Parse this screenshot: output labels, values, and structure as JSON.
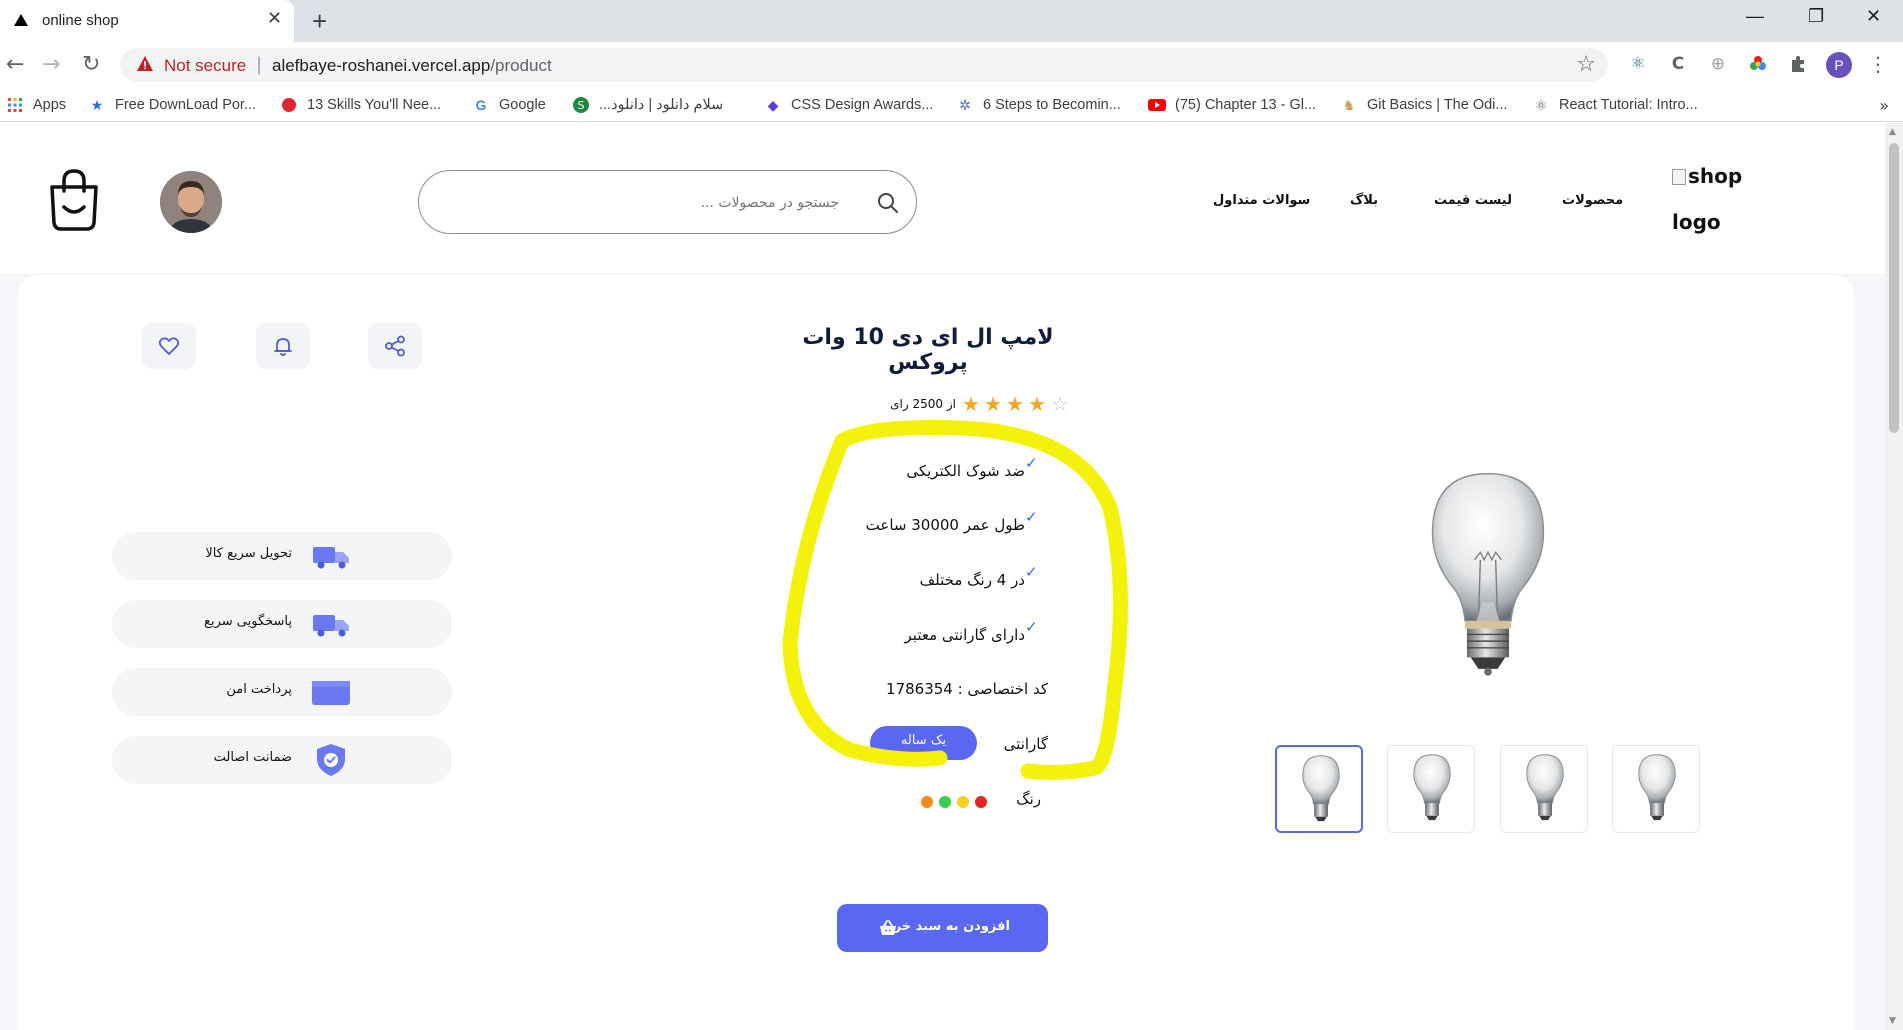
{
  "browser": {
    "tab_title": "online shop",
    "tab_close": "✕",
    "new_tab": "+",
    "url_warning": "Not secure",
    "url_host": "alefbaye-roshanei.vercel.app",
    "url_path": "/product",
    "profile_initial": "P",
    "window_controls": {
      "minimize": "—",
      "restore": "❐",
      "close": "✕"
    }
  },
  "bookmarks": [
    {
      "label": "Apps",
      "icon": "apps-grid-icon"
    },
    {
      "label": "Free DownLoad Por...",
      "icon": "star-icon"
    },
    {
      "label": "13 Skills You'll Nee...",
      "icon": "red-circle-icon"
    },
    {
      "label": "Google",
      "icon": "google-icon"
    },
    {
      "label": "سلام دانلود | دانلود...",
      "icon": "green-s-icon"
    },
    {
      "label": "CSS Design Awards...",
      "icon": "cssda-icon"
    },
    {
      "label": "6 Steps to Becomin...",
      "icon": "snowflake-icon"
    },
    {
      "label": "(75) Chapter 13 - Gl...",
      "icon": "youtube-icon"
    },
    {
      "label": "Git Basics | The Odi...",
      "icon": "odin-icon"
    },
    {
      "label": "React Tutorial: Intro...",
      "icon": "react-icon"
    }
  ],
  "header": {
    "search_placeholder": "جستجو در محصولات ...",
    "nav": [
      "محصولات",
      "لیست قیمت",
      "بلاگ",
      "سوالات متداول"
    ],
    "logo_alt": "shop logo"
  },
  "actions": [
    "share-icon",
    "bell-icon",
    "heart-icon"
  ],
  "features": [
    {
      "label": "تحویل سریع کالا",
      "icon": "truck-icon"
    },
    {
      "label": "پاسخگویی سریع",
      "icon": "truck-icon"
    },
    {
      "label": "پرداخت امن",
      "icon": "card-icon"
    },
    {
      "label": "ضمانت اصالت",
      "icon": "shield-check-icon"
    }
  ],
  "product": {
    "title": "لامپ ال ای دی 10 وات پروکس",
    "rating": {
      "value": 4,
      "max": 5,
      "text": "از 2500 رای"
    },
    "specs": [
      "ضد شوک الکتریکی",
      "طول عمر 30000 ساعت",
      "در 4 رنگ مختلف",
      "دارای گارانتی معتبر"
    ],
    "code_label": "کد اختصاصی : 1786354",
    "warranty_label": "گارانتی",
    "warranty_value": "یک ساله",
    "color_label": "رنگ",
    "colors": [
      "#e8231f",
      "#f2d21b",
      "#33d14a",
      "#f28b1b"
    ],
    "add_to_cart": "افزودن به سبد خرید"
  },
  "colors": {
    "accent": "#5a67f1",
    "highlight": "#f4f20a",
    "check": "#2d6cdf"
  }
}
